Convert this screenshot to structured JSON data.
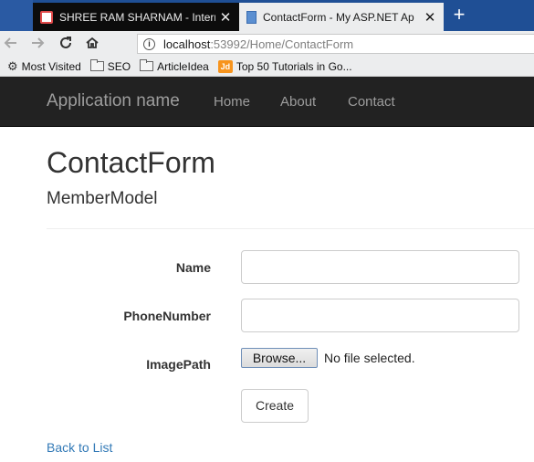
{
  "browser": {
    "tabs": [
      {
        "title": "SHREE RAM SHARNAM - Intern",
        "close": "✕",
        "active": false
      },
      {
        "title": "ContactForm - My ASP.NET Ap",
        "close": "✕",
        "active": true
      }
    ],
    "new_tab": "+",
    "url": {
      "host": "localhost",
      "rest": ":53992/Home/ContactForm"
    },
    "bookmarks": [
      {
        "label": "Most Visited",
        "icon": "gear-icon"
      },
      {
        "label": "SEO",
        "icon": "folder-icon"
      },
      {
        "label": "ArticleIdea",
        "icon": "folder-icon"
      },
      {
        "label": "Top 50 Tutorials in Go...",
        "icon": "jd-icon"
      }
    ]
  },
  "site": {
    "brand": "Application name",
    "nav": [
      "Home",
      "About",
      "Contact"
    ]
  },
  "page": {
    "title": "ContactForm",
    "subtitle": "MemberModel"
  },
  "form": {
    "name_label": "Name",
    "name_value": "",
    "phone_label": "PhoneNumber",
    "phone_value": "",
    "image_label": "ImagePath",
    "browse_label": "Browse...",
    "file_status": "No file selected.",
    "submit_label": "Create"
  },
  "back_link": "Back to List",
  "colors": {
    "navbar_bg": "#222222",
    "navbar_text": "#9d9d9d",
    "link": "#337ab7",
    "tabstrip": "#1f4f95"
  }
}
